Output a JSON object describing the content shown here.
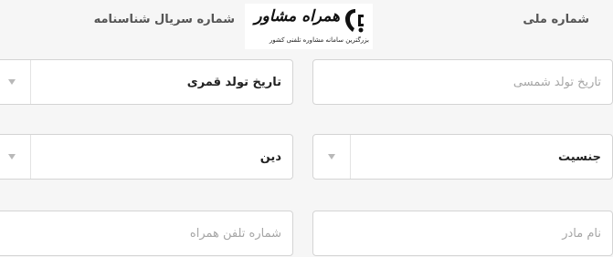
{
  "columns": {
    "right_label": "شماره ملی",
    "left_label": "شماره سریال شناسنامه"
  },
  "logo": {
    "name": "همراه مشاور",
    "tagline": "بزرگترین سامانه مشاوره تلفنی کشور"
  },
  "fields": {
    "solar_birth_date": {
      "placeholder": "تاریخ تولد شمسی"
    },
    "lunar_birth_date": {
      "value": "تاریخ تولد قمری"
    },
    "gender": {
      "value": "جنسیت"
    },
    "religion": {
      "value": "دین"
    },
    "mother_name": {
      "placeholder": "نام مادر"
    },
    "companion_phone": {
      "placeholder": "شماره تلفن همراه"
    }
  },
  "icons": {
    "dropdown": "chevron-down-icon",
    "logo": "phone-mark-icon"
  }
}
